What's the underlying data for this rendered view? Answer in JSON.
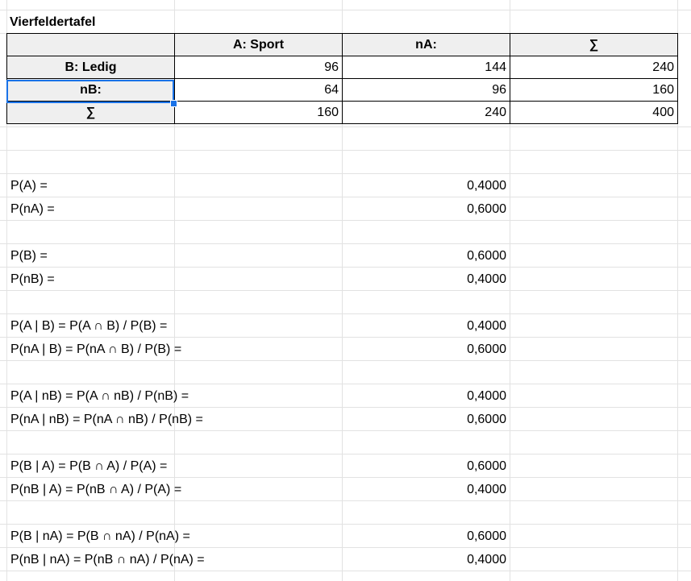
{
  "sheet": {
    "title": "Vierfeldertafel",
    "table": {
      "header": [
        "",
        "A: Sport",
        "nA:",
        "∑"
      ],
      "rows": [
        {
          "label": "B: Ledig",
          "values": [
            "96",
            "144",
            "240"
          ]
        },
        {
          "label": "nB:",
          "values": [
            "64",
            "96",
            "160"
          ]
        },
        {
          "label": "∑",
          "values": [
            "160",
            "240",
            "400"
          ]
        }
      ]
    },
    "selected_cell": "nB:",
    "probabilities": [
      {
        "label": "P(A) =",
        "value": "0,4000"
      },
      {
        "label": "P(nA) =",
        "value": "0,6000"
      },
      {
        "label": "P(B) =",
        "value": "0,6000"
      },
      {
        "label": "P(nB) =",
        "value": "0,4000"
      },
      {
        "label": "P(A | B) = P(A ∩ B) / P(B) =",
        "value": "0,4000"
      },
      {
        "label": "P(nA | B) = P(nA ∩ B) / P(B) =",
        "value": "0,6000"
      },
      {
        "label": "P(A | nB) = P(A ∩ nB) / P(nB) =",
        "value": "0,4000"
      },
      {
        "label": "P(nA | nB) = P(nA ∩ nB) / P(nB) =",
        "value": "0,6000"
      },
      {
        "label": "P(B | A) = P(B ∩ A) / P(A) =",
        "value": "0,6000"
      },
      {
        "label": "P(nB | A) = P(nB ∩ A) / P(A) =",
        "value": "0,4000"
      },
      {
        "label": "P(B | nA) = P(B ∩ nA) / P(nA) =",
        "value": "0,6000"
      },
      {
        "label": "P(nB | nA) = P(nB ∩ nA) / P(nA) =",
        "value": "0,4000"
      }
    ],
    "colors": {
      "header_fill": "#efefef",
      "gridline": "#e2e2e2",
      "selection": "#1a73e8"
    }
  }
}
